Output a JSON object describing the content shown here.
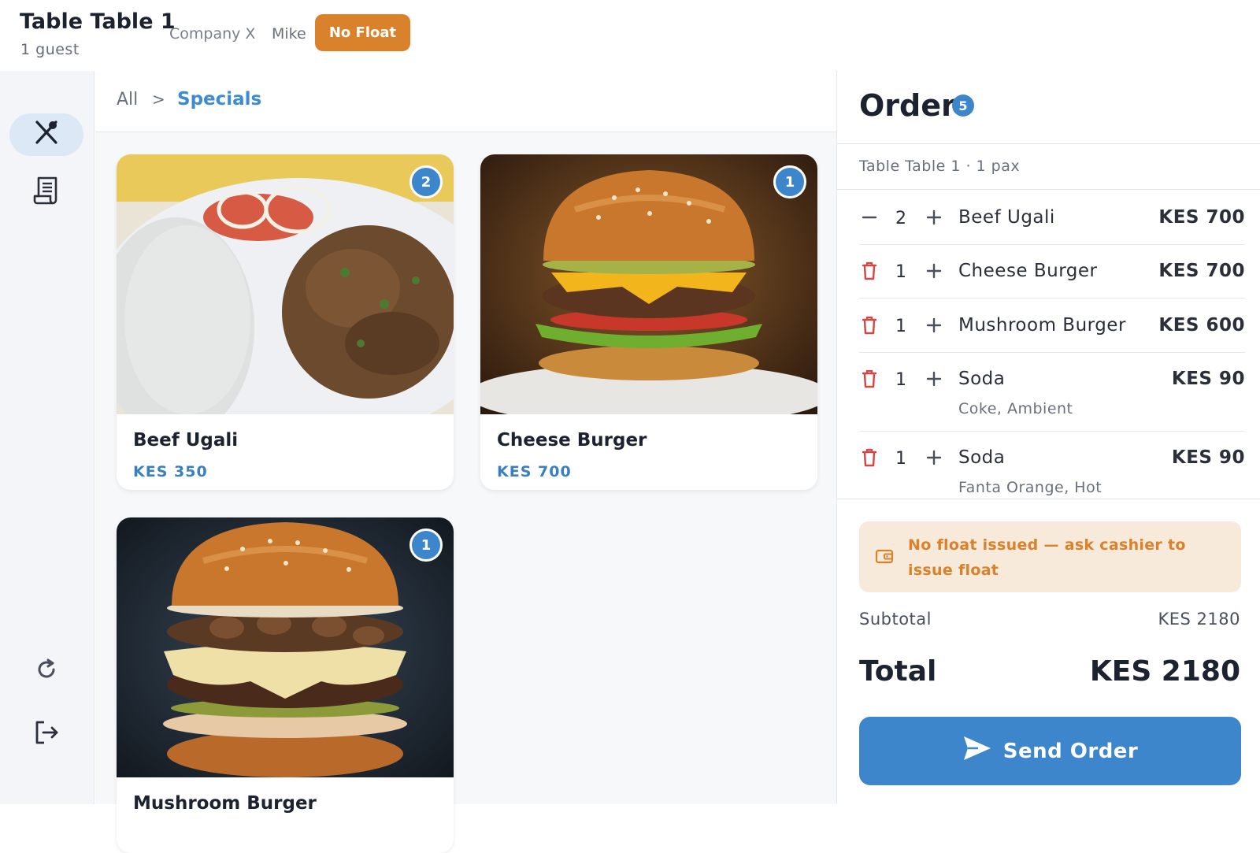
{
  "header": {
    "table_title": "Table Table 1",
    "guests": "1 guest",
    "company": "Company X",
    "waiter": "Mike",
    "float_badge": "No Float"
  },
  "rail": {
    "items": [
      {
        "icon": "utensils-icon",
        "active": true
      },
      {
        "icon": "receipt-icon",
        "active": false
      },
      {
        "icon": "refresh-icon",
        "active": false
      },
      {
        "icon": "logout-icon",
        "active": false
      }
    ]
  },
  "breadcrumb": {
    "root": "All",
    "separator": ">",
    "current": "Specials"
  },
  "products": [
    {
      "name": "Beef Ugali",
      "price": "KES 350",
      "in_order": "2"
    },
    {
      "name": "Cheese Burger",
      "price": "KES 700",
      "in_order": "1"
    },
    {
      "name": "Mushroom Burger",
      "price": "",
      "in_order": "1"
    }
  ],
  "order": {
    "title": "Order",
    "count": "5",
    "subtitle": "Table Table 1 · 1 pax",
    "lines": [
      {
        "qty": "2",
        "name": "Beef Ugali",
        "price": "KES 700",
        "note": "",
        "ctrl": "minus"
      },
      {
        "qty": "1",
        "name": "Cheese Burger",
        "price": "KES 700",
        "note": "",
        "ctrl": "trash"
      },
      {
        "qty": "1",
        "name": "Mushroom Burger",
        "price": "KES 600",
        "note": "",
        "ctrl": "trash"
      },
      {
        "qty": "1",
        "name": "Soda",
        "price": "KES 90",
        "note": "Coke, Ambient",
        "ctrl": "trash"
      },
      {
        "qty": "1",
        "name": "Soda",
        "price": "KES 90",
        "note": "Fanta Orange, Hot",
        "ctrl": "trash"
      }
    ],
    "warning": "No float issued — ask cashier to issue float",
    "subtotal_label": "Subtotal",
    "subtotal_value": "KES 2180",
    "total_label": "Total",
    "total_value": "KES 2180",
    "send_label": "Send Order"
  },
  "colors": {
    "accent": "#3d86cc",
    "warning": "#d9822b",
    "danger": "#d64545"
  }
}
